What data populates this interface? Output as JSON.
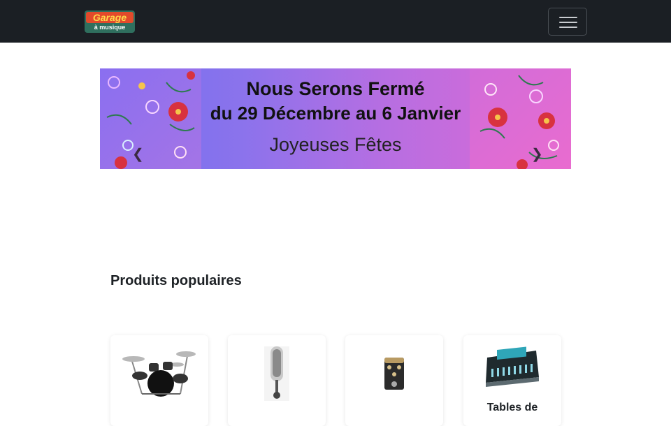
{
  "header": {
    "logo_text": "Garage à musique",
    "menu_toggle_icon": "hamburger-icon"
  },
  "banner": {
    "line1": "Nous Serons Fermé",
    "line2": "du 29 Décembre au 6 Janvier",
    "line3": "Joyeuses Fêtes",
    "prev_icon": "chevron-left-icon",
    "next_icon": "chevron-right-icon"
  },
  "popular": {
    "title": "Produits populaires",
    "products": [
      {
        "name": "",
        "image": "drum-kit"
      },
      {
        "name": "",
        "image": "microphone"
      },
      {
        "name": "",
        "image": "effects-pedal"
      },
      {
        "name": "Tables de",
        "image": "mixing-console"
      }
    ]
  },
  "colors": {
    "nav_bg": "#1b1f24",
    "accent_purple": "#7b6ff0",
    "accent_pink": "#e06ad3"
  }
}
